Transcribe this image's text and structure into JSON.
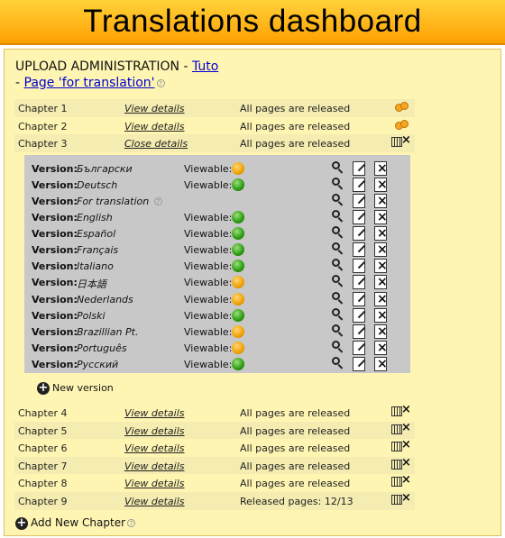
{
  "header": {
    "title": "Translations dashboard"
  },
  "upload": {
    "prefix": "UPLOAD ADMINISTRATION - ",
    "tuto_link": "Tuto",
    "dash": "- ",
    "page_link": "Page 'for translation'"
  },
  "chapters_before": [
    {
      "name": "Chapter 1",
      "link": "View details",
      "status": "All pages are released",
      "icon": "coins-icon"
    },
    {
      "name": "Chapter 2",
      "link": "View details",
      "status": "All pages are released",
      "icon": "coins-icon"
    },
    {
      "name": "Chapter 3",
      "link": "Close details",
      "status": "All pages are released",
      "icon": "grid-delete-icon"
    }
  ],
  "versions": {
    "label": "Version:",
    "viewable_label": "Viewable:",
    "items": [
      {
        "name": "Български",
        "viewable": "orange"
      },
      {
        "name": "Deutsch",
        "viewable": "green"
      },
      {
        "name": "For translation",
        "viewable": "",
        "help": true
      },
      {
        "name": "English",
        "viewable": "green"
      },
      {
        "name": "Español",
        "viewable": "green"
      },
      {
        "name": "Français",
        "viewable": "green"
      },
      {
        "name": "Italiano",
        "viewable": "green"
      },
      {
        "name": "日本語",
        "viewable": "orange"
      },
      {
        "name": "Nederlands",
        "viewable": "orange"
      },
      {
        "name": "Polski",
        "viewable": "green"
      },
      {
        "name": "Brazillian Pt.",
        "viewable": "orange"
      },
      {
        "name": "Português",
        "viewable": "orange"
      },
      {
        "name": "Русский",
        "viewable": "green"
      }
    ],
    "new_version": "New version"
  },
  "chapters_after": [
    {
      "name": "Chapter 4",
      "link": "View details",
      "status": "All pages are released"
    },
    {
      "name": "Chapter 5",
      "link": "View details",
      "status": "All pages are released"
    },
    {
      "name": "Chapter 6",
      "link": "View details",
      "status": "All pages are released"
    },
    {
      "name": "Chapter 7",
      "link": "View details",
      "status": "All pages are released"
    },
    {
      "name": "Chapter 8",
      "link": "View details",
      "status": "All pages are released"
    },
    {
      "name": "Chapter 9",
      "link": "View details",
      "status": "Released pages: 12/13"
    }
  ],
  "add_chapter": "Add New Chapter",
  "colors": {
    "banner": "#ffa000",
    "panel": "#fff5b3",
    "versions_bg": "#c8c8c8",
    "link": "#0000d0",
    "green": "#2a9a10",
    "orange": "#f0a000"
  }
}
